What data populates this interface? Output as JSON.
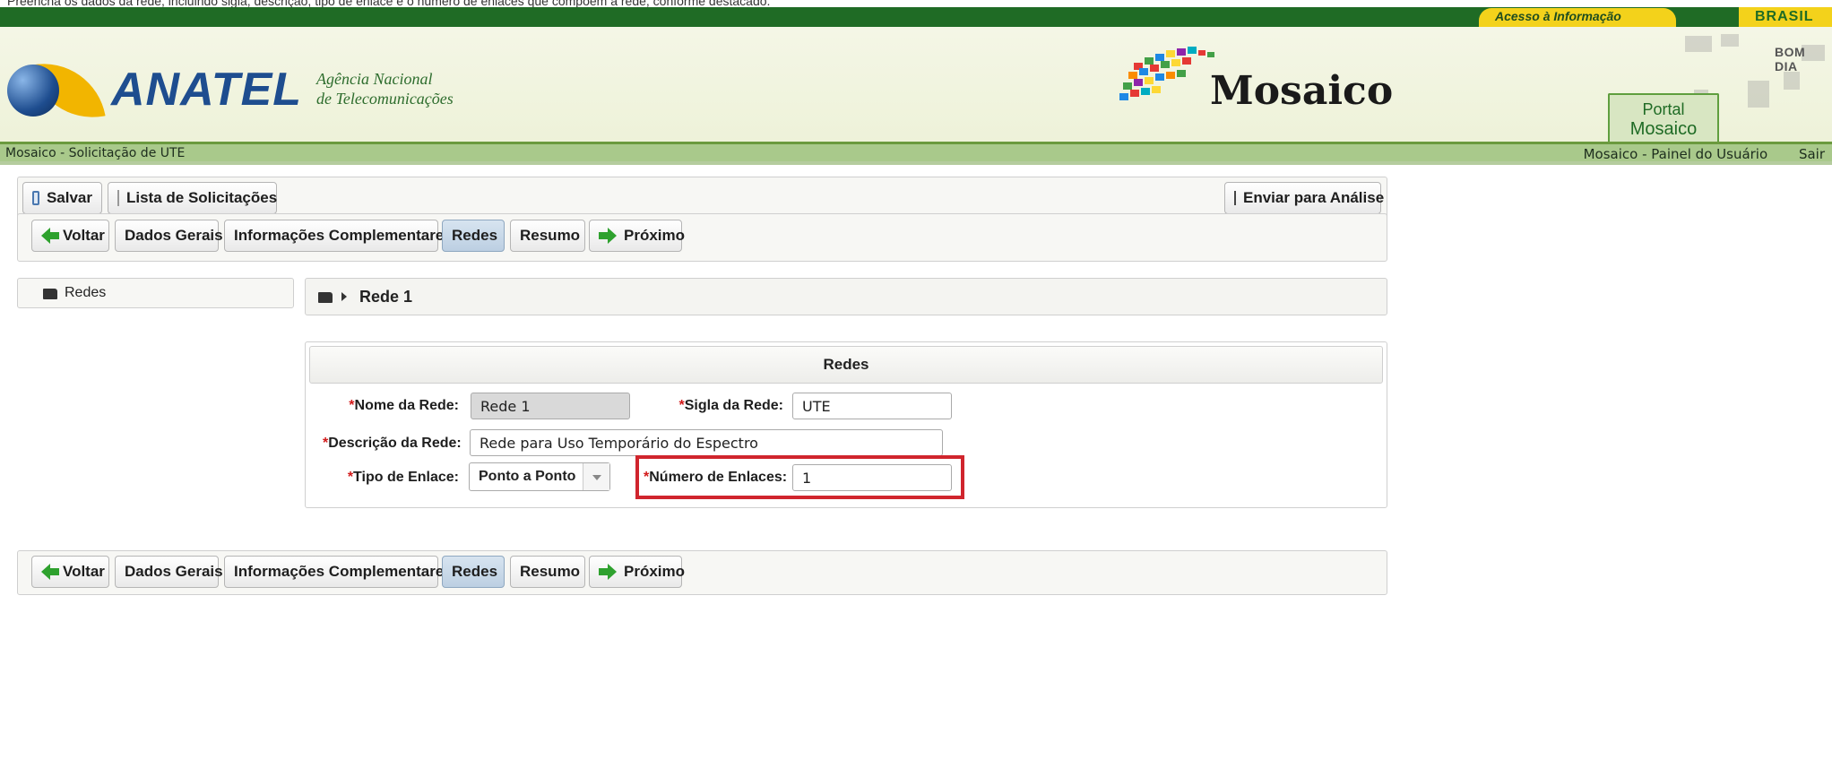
{
  "top_note": "Preencha os dados da rede, incluindo sigla, descrição, tipo de enlace e o número de enlaces que compõem a rede, conforme destacado.",
  "gov": {
    "link": "Acesso à Informação",
    "brasil": "BRASIL"
  },
  "header": {
    "logo": "ANATEL",
    "org_line1": "Agência Nacional",
    "org_line2": "de Telecomunicações",
    "app_title": "Mosaico",
    "greeting": "BOM DIA",
    "portal_line1": "Portal",
    "portal_line2": "Mosaico"
  },
  "nav": {
    "breadcrumb": "Mosaico - Solicitação de UTE",
    "user_panel": "Mosaico - Painel do Usuário",
    "logout": "Sair"
  },
  "toolbar": {
    "save": "Salvar",
    "list": "Lista de Solicitações",
    "submit": "Enviar para Análise"
  },
  "steps": {
    "back": "Voltar",
    "general": "Dados Gerais",
    "complementary": "Informações Complementares",
    "networks": "Redes",
    "summary": "Resumo",
    "next": "Próximo",
    "active": "Redes"
  },
  "tree": {
    "root": "Redes"
  },
  "main": {
    "breadcrumb": "Rede 1"
  },
  "form": {
    "title": "Redes",
    "required_mark": "*",
    "name_label": "Nome da Rede:",
    "name_value": "Rede 1",
    "acronym_label": "Sigla da Rede:",
    "acronym_value": "UTE",
    "description_label": "Descrição da Rede:",
    "description_value": "Rede para Uso Temporário do Espectro",
    "link_type_label": "Tipo de Enlace:",
    "link_type_value": "Ponto a Ponto",
    "link_count_label": "Número de Enlaces:",
    "link_count_value": "1"
  },
  "colors": {
    "gov_green": "#1f6b25",
    "gov_yellow": "#f3d21b",
    "highlight_red": "#d0252d",
    "active_step": "#bccfe2"
  }
}
